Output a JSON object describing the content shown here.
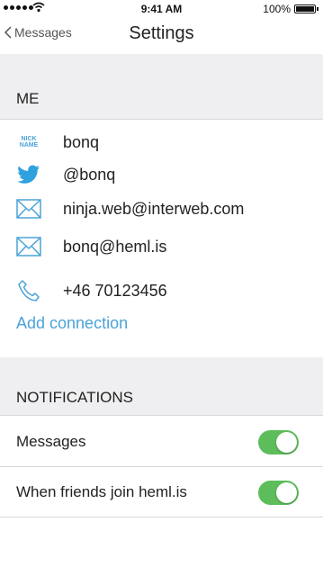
{
  "status_bar": {
    "time": "9:41 AM",
    "battery": "100%"
  },
  "nav": {
    "back_label": "Messages",
    "title": "Settings"
  },
  "me_section": {
    "header": "ME",
    "nick_icon_text": "NICK NAME",
    "items": [
      {
        "icon": "nickname-icon",
        "value": "bonq"
      },
      {
        "icon": "twitter-icon",
        "value": "@bonq"
      },
      {
        "icon": "mail-icon",
        "value": "ninja.web@interweb.com"
      },
      {
        "icon": "mail-icon",
        "value": "bonq@heml.is"
      },
      {
        "icon": "phone-icon",
        "value": "+46 70123456"
      }
    ],
    "add_connection": "Add connection"
  },
  "notifications_section": {
    "header": "NOTIFICATIONS",
    "items": [
      {
        "label": "Messages",
        "enabled": true
      },
      {
        "label": "When friends join heml.is",
        "enabled": true
      }
    ]
  },
  "colors": {
    "accent": "#4aa3d8",
    "toggle_on": "#5dbd5a",
    "section_bg": "#efeff1"
  }
}
